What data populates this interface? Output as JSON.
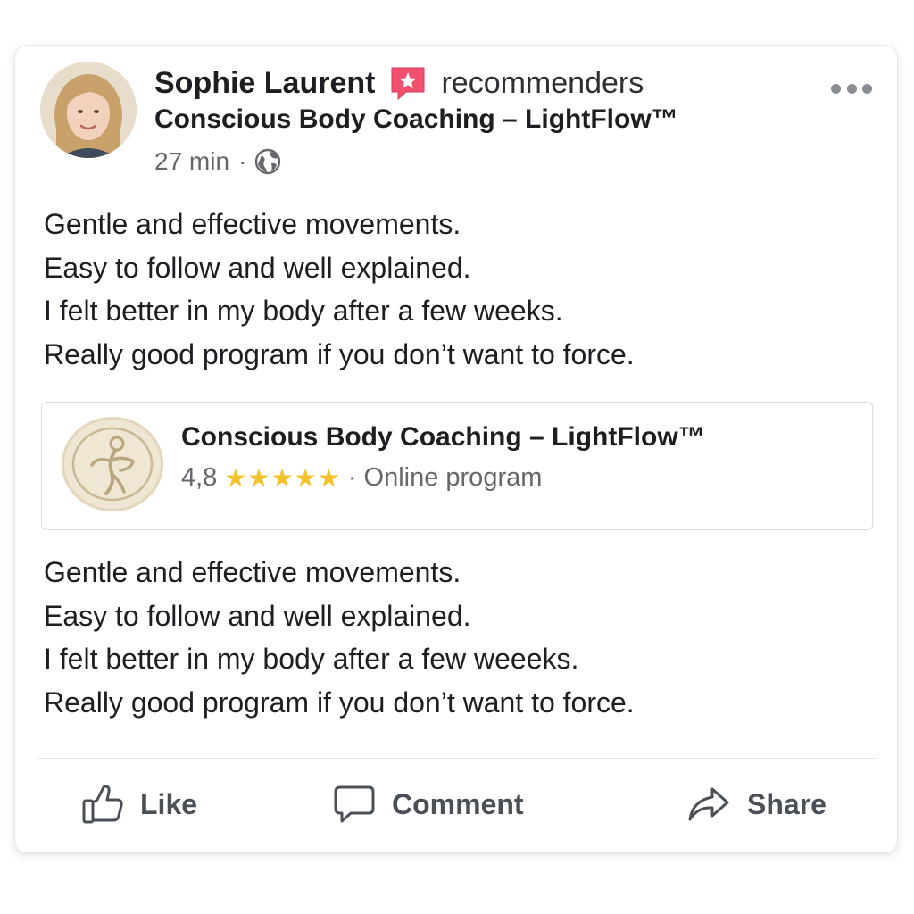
{
  "post": {
    "author": {
      "name": "Sophie Laurent",
      "badge_icon": "recommend-star-icon",
      "badge_label": "recommenders"
    },
    "subtitle": "Conscious Body Coaching – LightFlow™",
    "meta": {
      "time": "27 min",
      "separator": "·",
      "audience_icon": "globe-icon"
    },
    "text_lines": [
      "Gentle and effective movements.",
      "Easy to follow and well explained.",
      "I felt better in my body after a few weeks.",
      "Really good program if you don’t want to force."
    ],
    "more_icon": "more-options-icon"
  },
  "preview": {
    "title": "Conscious Body Coaching – LightFlow™",
    "rating": "4,8",
    "rating_stars": 5,
    "stars_text": "★★★★★",
    "separator": "·",
    "category": "Online program"
  },
  "repeat_text_lines": [
    "Gentle and effective movements.",
    "Easy to follow and well explained.",
    "I felt better in my body after a few weeeks.",
    "Really good program if you don’t want to force."
  ],
  "actions": {
    "like": {
      "label": "Like",
      "icon": "thumbs-up-icon"
    },
    "comment": {
      "label": "Comment",
      "icon": "comment-bubble-icon"
    },
    "share": {
      "label": "Share",
      "icon": "share-arrow-icon"
    }
  },
  "colors": {
    "badge": "#f0506e",
    "stars": "#f5c22b",
    "secondary_text": "#65676b"
  }
}
